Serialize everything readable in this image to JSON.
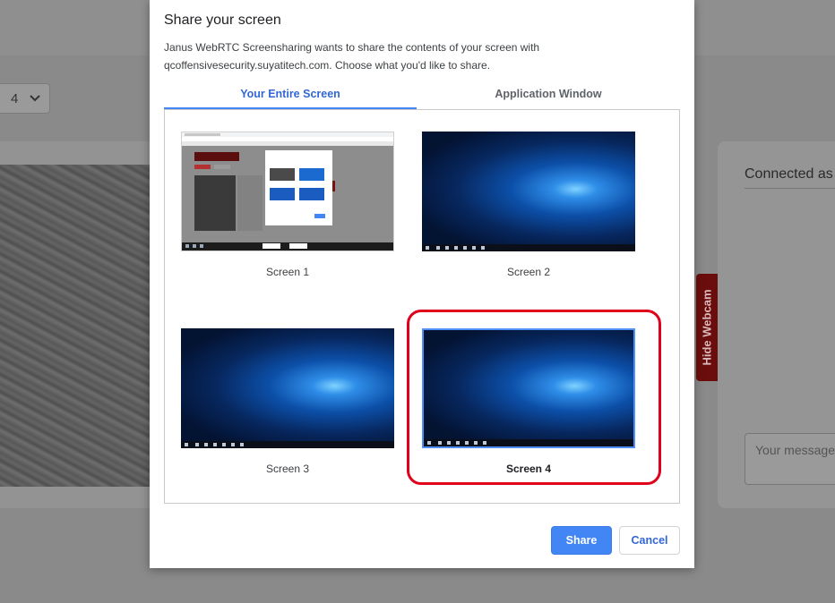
{
  "background": {
    "select_value": "4",
    "chat_title": "Connected as J",
    "message_placeholder": "Your message",
    "hide_webcam_label": "Hide Webcam"
  },
  "dialog": {
    "title": "Share your screen",
    "description_line1": "Janus WebRTC Screensharing wants to share the contents of your screen with",
    "description_line2": "qcoffensivesecurity.suyatitech.com. Choose what you'd like to share.",
    "tabs": [
      {
        "label": "Your Entire Screen",
        "active": true
      },
      {
        "label": "Application Window",
        "active": false
      }
    ],
    "screens": [
      {
        "label": "Screen 1",
        "selected": false
      },
      {
        "label": "Screen 2",
        "selected": false
      },
      {
        "label": "Screen 3",
        "selected": false
      },
      {
        "label": "Screen 4",
        "selected": true
      }
    ],
    "share_label": "Share",
    "cancel_label": "Cancel"
  },
  "colors": {
    "accent": "#4285f4",
    "highlight": "#e0001b",
    "webcam_button": "#6b0d0d"
  }
}
